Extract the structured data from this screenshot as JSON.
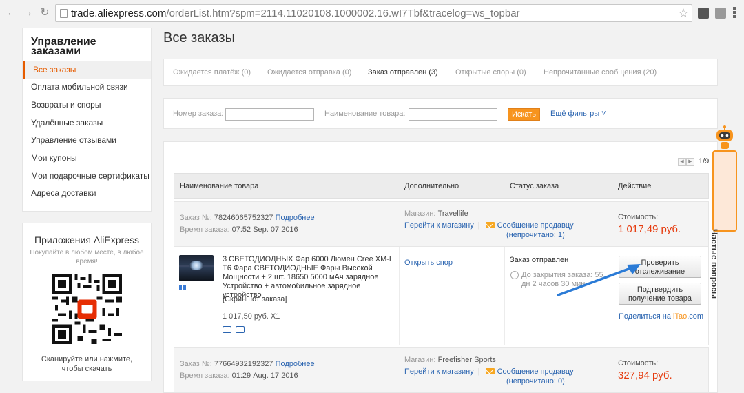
{
  "browser": {
    "url_host": "trade.aliexpress.com",
    "url_path": "/orderList.htm?spm=2114.11020108.1000002.16.wI7Tbf&tracelog=ws_topbar"
  },
  "sidebar": {
    "title": "Управление заказами",
    "items": [
      {
        "label": "Все заказы"
      },
      {
        "label": "Оплата мобильной связи"
      },
      {
        "label": "Возвраты и споры"
      },
      {
        "label": "Удалённые заказы"
      },
      {
        "label": "Управление отзывами"
      },
      {
        "label": "Мои купоны"
      },
      {
        "label": "Мои подарочные сертификаты"
      },
      {
        "label": "Адреса доставки"
      }
    ]
  },
  "apps": {
    "title": "Приложения AliExpress",
    "subtitle": "Покупайте в любом месте, в любое время!",
    "footer": "Сканируйте или нажмите, чтобы скачать"
  },
  "page": {
    "title": "Все заказы"
  },
  "tabs": [
    {
      "label": "Ожидается платёж (0)"
    },
    {
      "label": "Ожидается отправка (0)"
    },
    {
      "label": "Заказ отправлен (3)"
    },
    {
      "label": "Открытые споры (0)"
    },
    {
      "label": "Непрочитанные сообщения (20)"
    }
  ],
  "filters": {
    "order_no_label": "Номер заказа:",
    "product_label": "Наименование товара:",
    "search_button": "Искать",
    "more_filters": "Ещё фильтры ˅"
  },
  "pager": {
    "text": "1/9"
  },
  "table": {
    "headers": [
      "Наименование товара",
      "Дополнительно",
      "Статус заказа",
      "Действие"
    ]
  },
  "orders": [
    {
      "order_no_label": "Заказ №:",
      "order_no": "78246065752327",
      "details_link": "Подробнее",
      "time_label": "Время заказа:",
      "time": "07:52 Sep. 07 2016",
      "store_label": "Магазин:",
      "store": "Travellife",
      "go_store": "Перейти к магазину",
      "message": "Сообщение продавцу",
      "unread": "(непрочитано: 1)",
      "cost_label": "Стоимость:",
      "cost": "1 017,49 руб.",
      "product_title": "3 СВЕТОДИОДНЫХ Фар 6000 Люмен Cree XM-L T6 Фара СВЕТОДИОДНЫЕ Фары Высокой Мощности + 2 шт. 18650 5000 мАч зарядное Устройство + автомобильное зарядное устройство",
      "screenshot_link": "[Скриншот заказа]",
      "price_qty": "1 017,50 руб. X1",
      "dispute_link": "Открыть спор",
      "status": "Заказ отправлен",
      "countdown": "До закрытия заказа: 55 дн 2 часов 30 мин",
      "btn_track": "Проверить отслеживание",
      "btn_confirm": "Подтвердить получение товара",
      "share_prefix": "Поделиться на ",
      "share_brand": "iTao",
      "share_suffix": ".com"
    },
    {
      "order_no_label": "Заказ №:",
      "order_no": "77664932192327",
      "details_link": "Подробнее",
      "time_label": "Время заказа:",
      "time": "01:29 Aug. 17 2016",
      "store_label": "Магазин:",
      "store": "Freefisher Sports",
      "go_store": "Перейти к магазину",
      "message": "Сообщение продавцу",
      "unread": "(непрочитано: 0)",
      "cost_label": "Стоимость:",
      "cost": "327,94 руб."
    }
  ],
  "faq": {
    "label": "Частые вопросы"
  },
  "colors": {
    "accent": "#f7941e",
    "link": "#2a64b0",
    "price": "#e63b0e"
  },
  "icons": [
    "back-arrow-icon",
    "forward-arrow-icon",
    "reload-icon",
    "page-icon",
    "star-icon",
    "menu-icon",
    "mail-icon",
    "clock-icon",
    "robot-icon",
    "qr-code"
  ]
}
